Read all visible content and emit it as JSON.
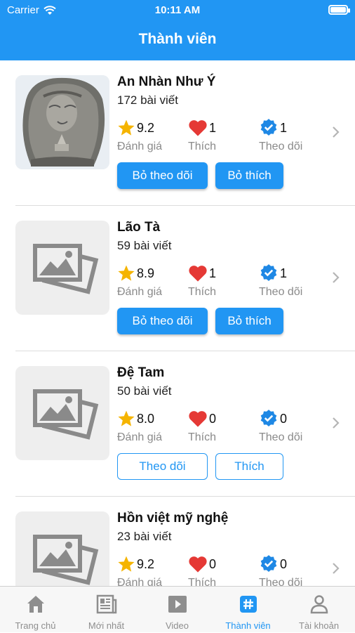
{
  "status_bar": {
    "carrier": "Carrier",
    "time": "10:11 AM"
  },
  "nav": {
    "title": "Thành viên"
  },
  "members": [
    {
      "name": "An Nhàn Như Ý",
      "posts": "172 bài viết",
      "rating": "9.2",
      "likes": "1",
      "follows": "1",
      "rating_label": "Đánh giá",
      "likes_label": "Thích",
      "follows_label": "Theo dõi",
      "button_follow": "Bỏ theo dõi",
      "button_like": "Bỏ thích",
      "followed": true,
      "avatar": "buddha-relief-photo"
    },
    {
      "name": "Lão Tà",
      "posts": "59 bài viết",
      "rating": "8.9",
      "likes": "1",
      "follows": "1",
      "rating_label": "Đánh giá",
      "likes_label": "Thích",
      "follows_label": "Theo dõi",
      "button_follow": "Bỏ theo dõi",
      "button_like": "Bỏ thích",
      "followed": true,
      "avatar": "image-placeholder-icon"
    },
    {
      "name": "Đệ Tam",
      "posts": "50 bài viết",
      "rating": "8.0",
      "likes": "0",
      "follows": "0",
      "rating_label": "Đánh giá",
      "likes_label": "Thích",
      "follows_label": "Theo dõi",
      "button_follow": "Theo dõi",
      "button_like": "Thích",
      "followed": false,
      "avatar": "image-placeholder-icon"
    },
    {
      "name": "Hồn việt mỹ nghệ",
      "posts": "23 bài viết",
      "rating": "9.2",
      "likes": "0",
      "follows": "0",
      "rating_label": "Đánh giá",
      "likes_label": "Thích",
      "follows_label": "Theo dõi",
      "avatar": "image-placeholder-icon"
    }
  ],
  "tabs": [
    {
      "label": "Trang chủ",
      "icon": "home-icon"
    },
    {
      "label": "Mới nhất",
      "icon": "newspaper-icon"
    },
    {
      "label": "Video",
      "icon": "video-icon"
    },
    {
      "label": "Thành viên",
      "icon": "hashtag-icon",
      "active": true
    },
    {
      "label": "Tài khoản",
      "icon": "user-icon"
    }
  ],
  "colors": {
    "primary": "#2196f3",
    "star": "#f5b400",
    "heart": "#e53935",
    "verified": "#1e88e5"
  }
}
